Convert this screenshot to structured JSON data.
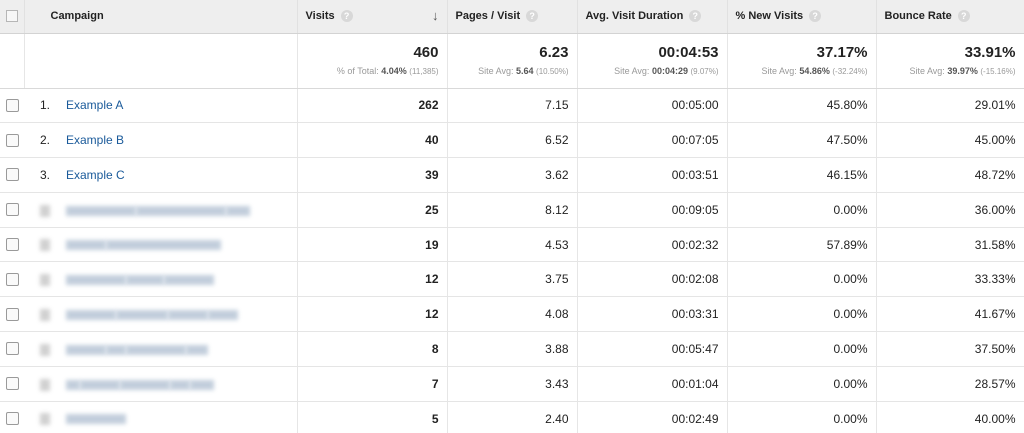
{
  "columns": {
    "campaign": "Campaign",
    "visits": "Visits",
    "pages_per_visit": "Pages / Visit",
    "avg_visit_duration": "Avg. Visit Duration",
    "pct_new_visits": "% New Visits",
    "bounce_rate": "Bounce Rate"
  },
  "totals": {
    "visits": {
      "value": "460",
      "label": "% of Total:",
      "bold": "4.04%",
      "paren": "(11,385)"
    },
    "pages_per_visit": {
      "value": "6.23",
      "label": "Site Avg:",
      "bold": "5.64",
      "paren": "(10.50%)"
    },
    "avg_visit_duration": {
      "value": "00:04:53",
      "label": "Site Avg:",
      "bold": "00:04:29",
      "paren": "(9.07%)"
    },
    "pct_new_visits": {
      "value": "37.17%",
      "label": "Site Avg:",
      "bold": "54.86%",
      "paren": "(-32.24%)"
    },
    "bounce_rate": {
      "value": "33.91%",
      "label": "Site Avg:",
      "bold": "39.97%",
      "paren": "(-15.16%)"
    }
  },
  "rows": [
    {
      "num": "1.",
      "campaign": "Example A",
      "visits": "262",
      "pages_per_visit": "7.15",
      "avg_visit_duration": "00:05:00",
      "pct_new_visits": "45.80%",
      "bounce_rate": "29.01%"
    },
    {
      "num": "2.",
      "campaign": "Example B",
      "visits": "40",
      "pages_per_visit": "6.52",
      "avg_visit_duration": "00:07:05",
      "pct_new_visits": "47.50%",
      "bounce_rate": "45.00%"
    },
    {
      "num": "3.",
      "campaign": "Example C",
      "visits": "39",
      "pages_per_visit": "3.62",
      "avg_visit_duration": "00:03:51",
      "pct_new_visits": "46.15%",
      "bounce_rate": "48.72%"
    },
    {
      "visits": "25",
      "pages_per_visit": "8.12",
      "avg_visit_duration": "00:09:05",
      "pct_new_visits": "0.00%",
      "bounce_rate": "36.00%"
    },
    {
      "visits": "19",
      "pages_per_visit": "4.53",
      "avg_visit_duration": "00:02:32",
      "pct_new_visits": "57.89%",
      "bounce_rate": "31.58%"
    },
    {
      "visits": "12",
      "pages_per_visit": "3.75",
      "avg_visit_duration": "00:02:08",
      "pct_new_visits": "0.00%",
      "bounce_rate": "33.33%"
    },
    {
      "visits": "12",
      "pages_per_visit": "4.08",
      "avg_visit_duration": "00:03:31",
      "pct_new_visits": "0.00%",
      "bounce_rate": "41.67%"
    },
    {
      "visits": "8",
      "pages_per_visit": "3.88",
      "avg_visit_duration": "00:05:47",
      "pct_new_visits": "0.00%",
      "bounce_rate": "37.50%"
    },
    {
      "visits": "7",
      "pages_per_visit": "3.43",
      "avg_visit_duration": "00:01:04",
      "pct_new_visits": "0.00%",
      "bounce_rate": "28.57%"
    },
    {
      "visits": "5",
      "pages_per_visit": "2.40",
      "avg_visit_duration": "00:02:49",
      "pct_new_visits": "0.00%",
      "bounce_rate": "40.00%"
    }
  ],
  "icons": {
    "help": "help-icon",
    "sort": "sort-descending-icon",
    "checkbox": "checkbox"
  },
  "colors": {
    "link": "#1a5a9a",
    "header_bg": "#eeeeee"
  }
}
